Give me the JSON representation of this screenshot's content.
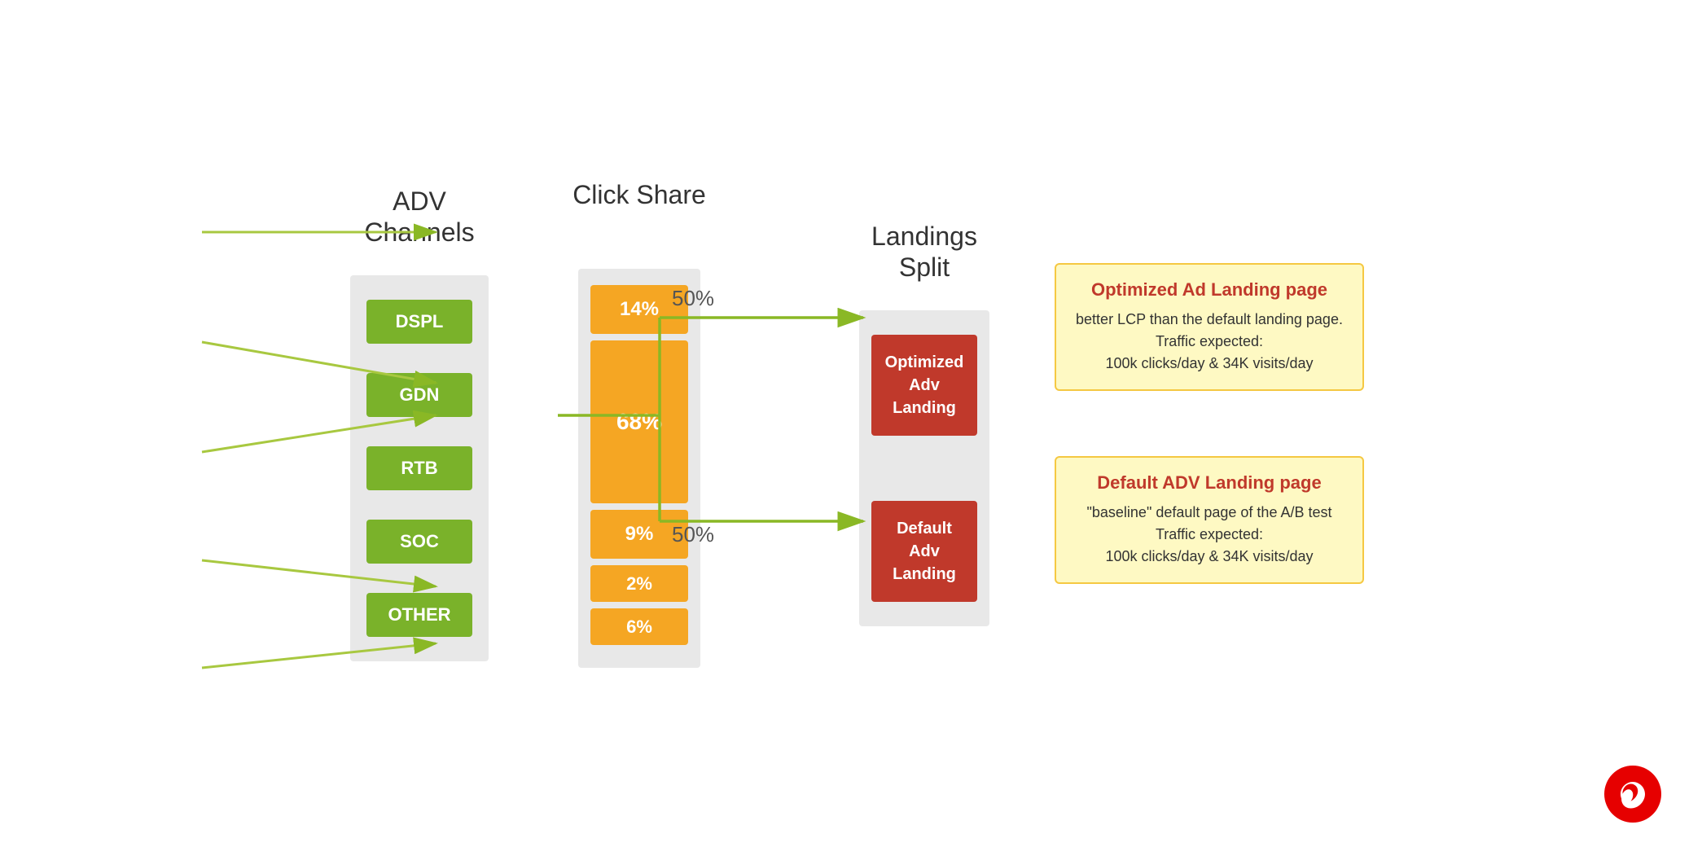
{
  "headers": {
    "adv": "ADV Channels",
    "click": "Click Share",
    "landings": "Landings Split"
  },
  "adv_channels": [
    {
      "label": "DSPL"
    },
    {
      "label": "GDN"
    },
    {
      "label": "RTB"
    },
    {
      "label": "SOC"
    },
    {
      "label": "OTHER"
    }
  ],
  "click_shares": [
    {
      "label": "14%",
      "size": "small"
    },
    {
      "label": "68%",
      "size": "large"
    },
    {
      "label": "9%",
      "size": "small"
    },
    {
      "label": "2%",
      "size": "tiny"
    },
    {
      "label": "6%",
      "size": "tiny"
    }
  ],
  "landings": [
    {
      "label": "Optimized Adv Landing"
    },
    {
      "label": "Default Adv Landing"
    }
  ],
  "split_labels": [
    {
      "label": "50%"
    },
    {
      "label": "50%"
    }
  ],
  "info_cards": [
    {
      "title": "Optimized Ad Landing page",
      "body": "better LCP than the default landing page.\nTraffic expected:\n100k clicks/day  & 34K visits/day"
    },
    {
      "title": "Default ADV Landing page",
      "body": "\"baseline\" default page of the A/B test\nTraffic expected:\n100k clicks/day  & 34K visits/day"
    }
  ],
  "colors": {
    "adv_box": "#7ab22a",
    "click_box": "#f5a623",
    "landing_box": "#c0392b",
    "info_card_bg": "#fef9c3",
    "info_card_border": "#f5c842",
    "info_title": "#c0392b",
    "arrow": "#8ab825",
    "bg_column": "#e8e8e8"
  }
}
